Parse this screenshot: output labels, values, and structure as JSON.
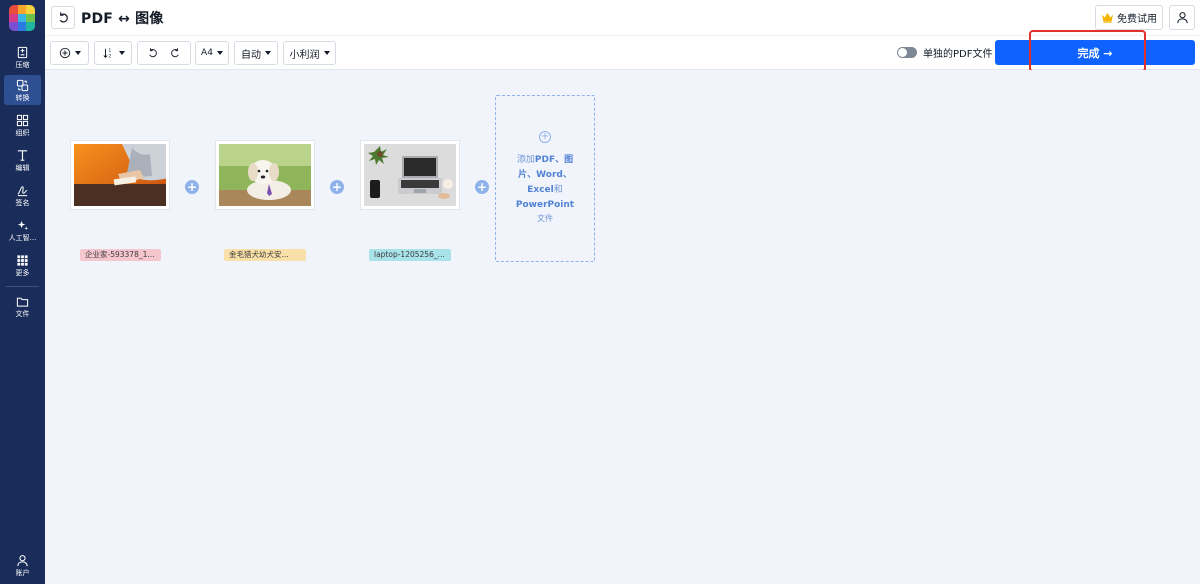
{
  "app": {
    "title": "PDF ↔ 图像"
  },
  "sidebar": {
    "items": [
      {
        "label": "压缩",
        "icon": "compress-icon"
      },
      {
        "label": "转换",
        "icon": "convert-icon",
        "active": true
      },
      {
        "label": "组织",
        "icon": "organize-grid-icon"
      },
      {
        "label": "编辑",
        "icon": "edit-text-icon"
      },
      {
        "label": "签名",
        "icon": "signature-icon"
      },
      {
        "label": "人工智...",
        "icon": "ai-sparkle-icon"
      },
      {
        "label": "更多",
        "icon": "more-grid-icon"
      },
      {
        "label": "文件",
        "icon": "folder-icon"
      }
    ],
    "account_label": "账户"
  },
  "header": {
    "trial_label": "免费试用"
  },
  "toolbar": {
    "page_size": "A4",
    "orientation": "自动",
    "margin": "小利润",
    "single_pdf_label": "单独的PDF文件",
    "single_pdf_on": false,
    "finish_label": "完成 →"
  },
  "files": [
    {
      "name": "企业家-593378_1...",
      "tag_color": "#f6c6cf",
      "image": "businessman-writing"
    },
    {
      "name": "金毛猎犬幼犬安...",
      "tag_color": "#f8e0a8",
      "image": "golden-retriever-puppy"
    },
    {
      "name": "laptop-1205256_...",
      "tag_color": "#a9e3ea",
      "image": "laptop-desk"
    }
  ],
  "add_box": {
    "line1_prefix": "添加",
    "line1_bold": "PDF、图",
    "line2_bold": "片、Word、",
    "line3_bold": "Excel",
    "line3_suffix": "和",
    "line4_bold": "PowerPoint",
    "line5": "文件"
  },
  "colors": {
    "sidebar_bg": "#1a2d5a",
    "sidebar_active": "#2f4f93",
    "primary_button": "#0f62fe",
    "highlight": "#e3302b",
    "canvas_bg": "#f1f5fb"
  }
}
